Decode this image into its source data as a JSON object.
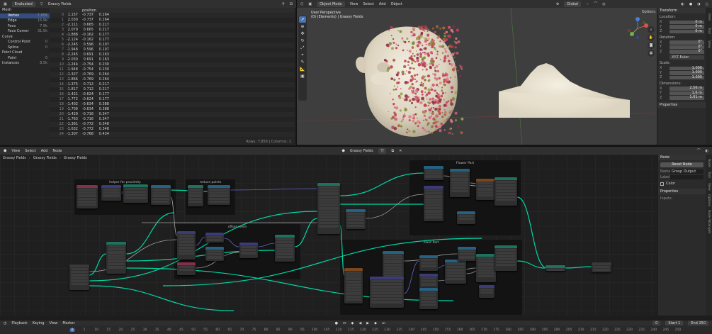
{
  "spreadsheet": {
    "mode": "Evaluated",
    "object": "Grassy Fields",
    "tree": [
      {
        "name": "Mesh",
        "count": "",
        "depth": 0,
        "selected": false
      },
      {
        "name": "Vertex",
        "count": "7,858",
        "depth": 1,
        "selected": true
      },
      {
        "name": "Edge",
        "count": "15.9k",
        "depth": 1,
        "selected": false
      },
      {
        "name": "Face",
        "count": "7.9k",
        "depth": 1,
        "selected": false
      },
      {
        "name": "Face Corner",
        "count": "31.5k",
        "depth": 1,
        "selected": false
      },
      {
        "name": "Curve",
        "count": "",
        "depth": 0,
        "selected": false
      },
      {
        "name": "Control Point",
        "count": "0",
        "depth": 1,
        "selected": false
      },
      {
        "name": "Spline",
        "count": "0",
        "depth": 1,
        "selected": false
      },
      {
        "name": "Point Cloud",
        "count": "",
        "depth": 0,
        "selected": false
      },
      {
        "name": "Point",
        "count": "0",
        "depth": 1,
        "selected": false
      },
      {
        "name": "Instances",
        "count": "8.5k",
        "depth": 0,
        "selected": false
      }
    ],
    "column_header": "position",
    "rows": [
      [
        "0",
        "1.157",
        "-0.737",
        "0.264"
      ],
      [
        "1",
        "2.030",
        "-0.737",
        "0.264"
      ],
      [
        "2",
        "-2.111",
        "0.665",
        "0.217"
      ],
      [
        "3",
        "2.079",
        "0.665",
        "0.217"
      ],
      [
        "4",
        "-1.888",
        "-0.162",
        "0.177"
      ],
      [
        "5",
        "-2.124",
        "-0.162",
        "0.177"
      ],
      [
        "6",
        "-2.245",
        "0.596",
        "0.107"
      ],
      [
        "7",
        "-1.948",
        "0.596",
        "0.107"
      ],
      [
        "8",
        "-2.245",
        "0.691",
        "0.163"
      ],
      [
        "9",
        "-2.030",
        "0.691",
        "0.163"
      ],
      [
        "10",
        "-1.244",
        "-0.754",
        "0.230"
      ],
      [
        "11",
        "-1.948",
        "-0.754",
        "0.230"
      ],
      [
        "12",
        "-1.327",
        "-0.769",
        "0.264"
      ],
      [
        "13",
        "-1.866",
        "-0.769",
        "0.264"
      ],
      [
        "14",
        "-1.375",
        "0.712",
        "0.217"
      ],
      [
        "15",
        "-1.817",
        "0.712",
        "0.217"
      ],
      [
        "16",
        "-1.421",
        "-0.624",
        "0.177"
      ],
      [
        "17",
        "-1.772",
        "-0.624",
        "0.177"
      ],
      [
        "18",
        "-1.402",
        "-0.634",
        "0.388"
      ],
      [
        "19",
        "-1.709",
        "-0.634",
        "0.388"
      ],
      [
        "20",
        "-1.429",
        "-0.716",
        "0.347"
      ],
      [
        "21",
        "-1.763",
        "-0.716",
        "0.347"
      ],
      [
        "22",
        "-1.361",
        "-0.772",
        "0.348"
      ],
      [
        "23",
        "-1.632",
        "-0.772",
        "0.348"
      ],
      [
        "24",
        "-1.307",
        "-0.768",
        "0.434"
      ]
    ],
    "footer": "Rows: 7,858 | Columns: 1"
  },
  "viewport": {
    "mode": "Object Mode",
    "menus": [
      "View",
      "Select",
      "Add",
      "Object"
    ],
    "orientation": "Global",
    "info_line1": "User Perspective",
    "info_line2": "(0) (Elements) | Grassy Fields",
    "options": "Options"
  },
  "properties": {
    "transform": "Transform",
    "location_label": "Location:",
    "location": [
      {
        "axis": "X",
        "value": "0 m"
      },
      {
        "axis": "Y",
        "value": "0 m"
      },
      {
        "axis": "Z",
        "value": "0 m"
      }
    ],
    "rotation_label": "Rotation:",
    "rotation": [
      {
        "axis": "X",
        "value": "0°"
      },
      {
        "axis": "Y",
        "value": "0°"
      },
      {
        "axis": "Z",
        "value": "0°"
      }
    ],
    "rotation_mode": "XYZ Euler",
    "scale_label": "Scale:",
    "scale": [
      {
        "axis": "X",
        "value": "1.000"
      },
      {
        "axis": "Y",
        "value": "1.000"
      },
      {
        "axis": "Z",
        "value": "1.000"
      }
    ],
    "dimensions_label": "Dimensions:",
    "dimensions": [
      {
        "axis": "X",
        "value": "2.56 m"
      },
      {
        "axis": "Y",
        "value": "1.6 m"
      },
      {
        "axis": "Z",
        "value": "1.01 m"
      }
    ],
    "section": "Properties",
    "tabs": [
      "Item",
      "Tool",
      "View"
    ]
  },
  "node_editor": {
    "menus": [
      "View",
      "Select",
      "Add",
      "Node"
    ],
    "tree_name": "Grassy Fields",
    "breadcrumb": [
      "Grassy Fields",
      "Grassy Fields",
      "Grassy Fields"
    ],
    "frames": {
      "helper": "helper for proximity",
      "reduce": "reduce points",
      "offset": "offset mesh",
      "flower": "Flower Part",
      "plant": "Plant Part"
    }
  },
  "node_side": {
    "header": "Node",
    "reset": "Reset Node",
    "name_label": "Name:",
    "name_value": "Group Output",
    "label_label": "Label:",
    "label_value": "",
    "color_label": "Color",
    "properties": "Properties",
    "inputs": "Inputs:",
    "tabs": [
      "Node",
      "Tool",
      "View",
      "Options",
      "Node Wrangler"
    ]
  },
  "timeline": {
    "menus": [
      "Playback",
      "Keying",
      "View",
      "Marker"
    ],
    "current_frame": "0",
    "start_label": "Start",
    "start": "1",
    "end_label": "End",
    "end": "250",
    "ticks": [
      "0",
      "5",
      "10",
      "15",
      "20",
      "25",
      "30",
      "35",
      "40",
      "45",
      "50",
      "55",
      "60",
      "65",
      "70",
      "75",
      "80",
      "85",
      "90",
      "95",
      "100",
      "105",
      "110",
      "115",
      "120",
      "125",
      "130",
      "135",
      "140",
      "145",
      "150",
      "155",
      "160",
      "165",
      "170",
      "175",
      "180",
      "185",
      "190",
      "195",
      "200",
      "205",
      "210",
      "215",
      "220",
      "225",
      "230",
      "235",
      "240",
      "245",
      "250"
    ]
  },
  "colors": {
    "accent": "#4772b3",
    "geometry_link": "#00d6a3",
    "vector_link": "#6363c7",
    "float_link": "#a1a1a1",
    "node_geometry": "#1d725e",
    "node_input": "#83314a",
    "node_vector": "#3b3b7a",
    "node_converter": "#246283",
    "node_texture": "#79461d"
  },
  "icons": [
    "cursor-icon",
    "move-icon",
    "rotate-icon",
    "scale-icon",
    "transform-icon",
    "annotate-icon",
    "measure-icon",
    "add-cube-icon",
    "zoom-icon",
    "pan-icon",
    "camera-icon",
    "grid-icon"
  ]
}
